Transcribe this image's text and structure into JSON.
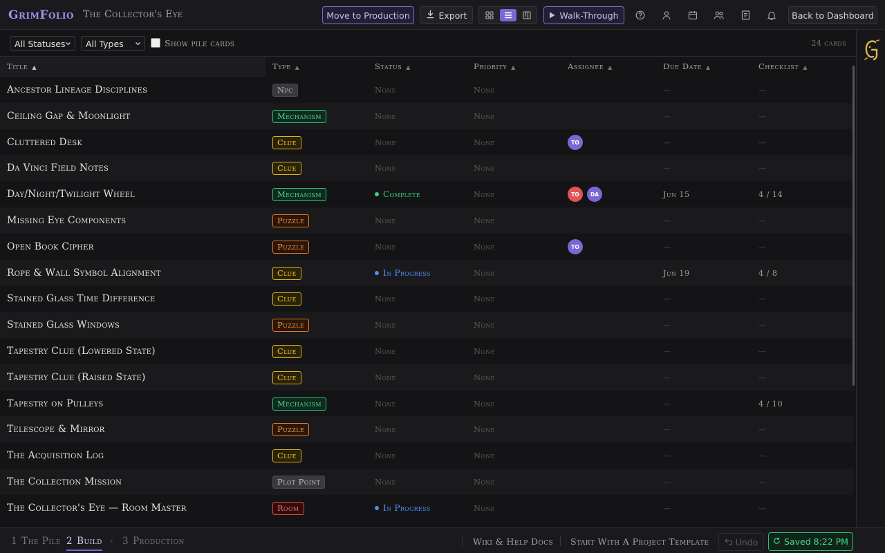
{
  "app": {
    "brand": "GrimFolio",
    "project": "The Collector's Eye"
  },
  "toolbar": {
    "move_to_production": "Move to Production",
    "export": "Export",
    "walkthrough": "Walk-Through",
    "back": "Back to Dashboard",
    "active_view": "list"
  },
  "filters": {
    "status": "All Statuses",
    "type": "All Types",
    "show_pile": "Show pile cards",
    "show_pile_checked": false,
    "count": "24 cards"
  },
  "columns": [
    "Title",
    "Type",
    "Status",
    "Priority",
    "Assignee",
    "Due Date",
    "Checklist"
  ],
  "sort": {
    "column": "Title",
    "direction": "ascending"
  },
  "rows": [
    {
      "title": "Ancestor Lineage Disciplines",
      "type": "Npc",
      "type_style": "npc",
      "status": "None",
      "status_style": "none",
      "priority": "None",
      "assignees": [],
      "due": "",
      "checklist": ""
    },
    {
      "title": "Ceiling Gap & Moonlight",
      "type": "Mechanism",
      "type_style": "mech",
      "status": "None",
      "status_style": "none",
      "priority": "None",
      "assignees": [],
      "due": "",
      "checklist": ""
    },
    {
      "title": "Cluttered Desk",
      "type": "Clue",
      "type_style": "clue",
      "status": "None",
      "status_style": "none",
      "priority": "None",
      "assignees": [
        {
          "initials": "TO",
          "color": "#7c66d6"
        }
      ],
      "due": "",
      "checklist": ""
    },
    {
      "title": "Da Vinci Field Notes",
      "type": "Clue",
      "type_style": "clue",
      "status": "None",
      "status_style": "none",
      "priority": "None",
      "assignees": [],
      "due": "",
      "checklist": ""
    },
    {
      "title": "Day/Night/Twilight Wheel",
      "type": "Mechanism",
      "type_style": "mech",
      "status": "Complete",
      "status_style": "complete",
      "priority": "None",
      "assignees": [
        {
          "initials": "TO",
          "color": "#e05555"
        },
        {
          "initials": "DA",
          "color": "#7c66d6"
        }
      ],
      "due": "Jun 15",
      "checklist": "4 / 14"
    },
    {
      "title": "Missing Eye Components",
      "type": "Puzzle",
      "type_style": "puzzle",
      "status": "None",
      "status_style": "none",
      "priority": "None",
      "assignees": [],
      "due": "",
      "checklist": ""
    },
    {
      "title": "Open Book Cipher",
      "type": "Puzzle",
      "type_style": "puzzle",
      "status": "None",
      "status_style": "none",
      "priority": "None",
      "assignees": [
        {
          "initials": "TO",
          "color": "#7c66d6"
        }
      ],
      "due": "",
      "checklist": ""
    },
    {
      "title": "Rope & Wall Symbol Alignment",
      "type": "Clue",
      "type_style": "clue",
      "status": "In Progress",
      "status_style": "progress",
      "priority": "None",
      "assignees": [],
      "due": "Jun 19",
      "checklist": "4 / 8"
    },
    {
      "title": "Stained Glass Time Difference",
      "type": "Clue",
      "type_style": "clue",
      "status": "None",
      "status_style": "none",
      "priority": "None",
      "assignees": [],
      "due": "",
      "checklist": ""
    },
    {
      "title": "Stained Glass Windows",
      "type": "Puzzle",
      "type_style": "puzzle",
      "status": "None",
      "status_style": "none",
      "priority": "None",
      "assignees": [],
      "due": "",
      "checklist": ""
    },
    {
      "title": "Tapestry Clue (Lowered State)",
      "type": "Clue",
      "type_style": "clue",
      "status": "None",
      "status_style": "none",
      "priority": "None",
      "assignees": [],
      "due": "",
      "checklist": ""
    },
    {
      "title": "Tapestry Clue (Raised State)",
      "type": "Clue",
      "type_style": "clue",
      "status": "None",
      "status_style": "none",
      "priority": "None",
      "assignees": [],
      "due": "",
      "checklist": ""
    },
    {
      "title": "Tapestry on Pulleys",
      "type": "Mechanism",
      "type_style": "mech",
      "status": "None",
      "status_style": "none",
      "priority": "None",
      "assignees": [],
      "due": "",
      "checklist": "4 / 10"
    },
    {
      "title": "Telescope & Mirror",
      "type": "Puzzle",
      "type_style": "puzzle",
      "status": "None",
      "status_style": "none",
      "priority": "None",
      "assignees": [],
      "due": "",
      "checklist": ""
    },
    {
      "title": "The Acquisition Log",
      "type": "Clue",
      "type_style": "clue",
      "status": "None",
      "status_style": "none",
      "priority": "None",
      "assignees": [],
      "due": "",
      "checklist": ""
    },
    {
      "title": "The Collection Mission",
      "type": "Plot Point",
      "type_style": "plot",
      "status": "None",
      "status_style": "none",
      "priority": "None",
      "assignees": [],
      "due": "",
      "checklist": ""
    },
    {
      "title": "The Collector's Eye — Room Master",
      "type": "Room",
      "type_style": "room",
      "status": "In Progress",
      "status_style": "progress",
      "priority": "None",
      "assignees": [],
      "due": "",
      "checklist": ""
    }
  ],
  "empty_placeholder": "—",
  "footer": {
    "steps": [
      {
        "num": "1",
        "label": "The Pile"
      },
      {
        "num": "2",
        "label": "Build"
      },
      {
        "num": "3",
        "label": "Production"
      }
    ],
    "active_step": 1,
    "step_separator": "›",
    "wiki": "Wiki & Help Docs",
    "template": "Start With A Project Template",
    "undo": "Undo",
    "saved": "Saved 8:22 PM"
  }
}
